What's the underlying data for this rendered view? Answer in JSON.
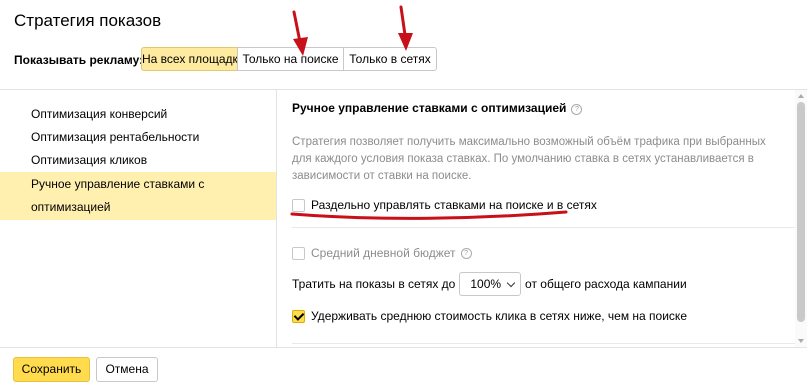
{
  "dialog": {
    "title": "Стратегия показов"
  },
  "placement": {
    "label": "Показывать рекламу:",
    "tabs": [
      {
        "label": "На всех площадках",
        "active": true
      },
      {
        "label": "Только на поиске",
        "active": false
      },
      {
        "label": "Только в сетях",
        "active": false
      }
    ]
  },
  "strategies": [
    {
      "label": "Оптимизация конверсий"
    },
    {
      "label": "Оптимизация рентабельности"
    },
    {
      "label": "Оптимизация кликов"
    },
    {
      "label": "Ручное управление ставками с оптимизацией",
      "selected": true
    }
  ],
  "panel": {
    "title": "Ручное управление ставками с оптимизацией",
    "help_icon": "question-circle-icon",
    "description": "Стратегия позволяет получить максимально возможный объём трафика при выбранных для каждого условия показа ставках. По умолчанию ставка в сетях устанавливается в зависимости от ставки на поиске.",
    "separate_bids": {
      "label": "Раздельно управлять ставками на поиске и в сетях",
      "checked": false
    },
    "daily_budget": {
      "label": "Средний дневной бюджет",
      "checked": false,
      "disabled": true
    },
    "network_spend": {
      "prefix": "Тратить на показы в сетях до",
      "value": "100%",
      "suffix": "от общего расхода кампании"
    },
    "keep_cpc_lower": {
      "label": "Удерживать среднюю стоимость клика в сетях ниже, чем на поиске",
      "checked": true
    }
  },
  "footer": {
    "save_label": "Сохранить",
    "cancel_label": "Отмена"
  },
  "colors": {
    "accent_yellow": "#ffdb4d",
    "selected_row": "#fff0b0",
    "annotation_red": "#c8101a"
  }
}
